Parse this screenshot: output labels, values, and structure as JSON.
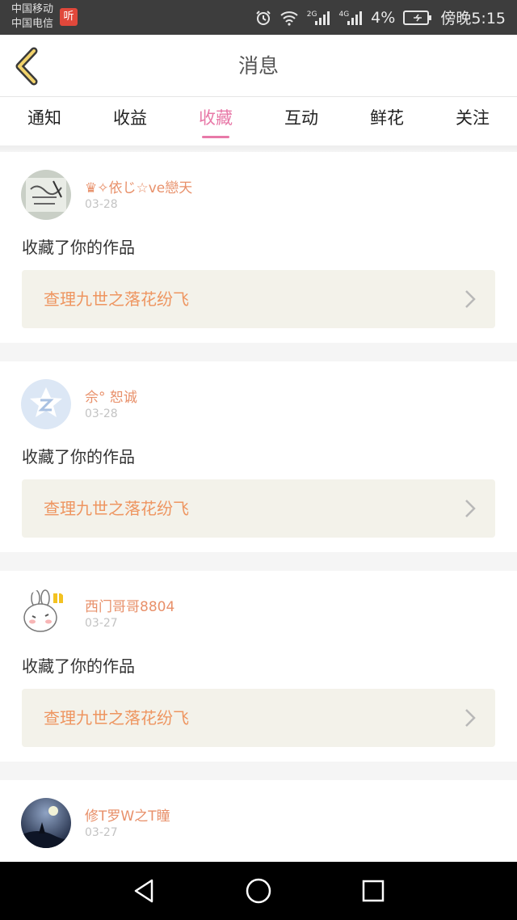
{
  "status": {
    "carrier1": "中国移动",
    "carrier2": "中国电信",
    "app_badge": "听",
    "net2": "2G",
    "net4": "4G",
    "battery": "4%",
    "time": "傍晚5:15"
  },
  "header": {
    "title": "消息"
  },
  "tabs": [
    {
      "label": "通知"
    },
    {
      "label": "收益"
    },
    {
      "label": "收藏"
    },
    {
      "label": "互动"
    },
    {
      "label": "鲜花"
    },
    {
      "label": "关注"
    }
  ],
  "active_tab": "收藏",
  "messages": [
    {
      "user": "♛✧依じ☆ve戀天",
      "date": "03-28",
      "action": "收藏了你的作品",
      "work": "查理九世之落花纷飞"
    },
    {
      "user": "佘° 恕诚",
      "date": "03-28",
      "action": "收藏了你的作品",
      "work": "查理九世之落花纷飞"
    },
    {
      "user": "西门哥哥8804",
      "date": "03-27",
      "action": "收藏了你的作品",
      "work": "查理九世之落花纷飞"
    },
    {
      "user": "修T罗W之T瞳",
      "date": "03-27",
      "action": "",
      "work": ""
    }
  ],
  "colors": {
    "accent": "#e879a8",
    "username": "#e8906a",
    "work_title": "#ee9560",
    "work_bg": "#f3f2ea"
  },
  "icons": {
    "back": "chevron-left-icon",
    "chevron": "chevron-right-icon",
    "alarm": "alarm-icon",
    "wifi": "wifi-icon",
    "signal": "signal-icon",
    "battery": "battery-icon",
    "nav_back": "triangle-back-icon",
    "nav_home": "circle-home-icon",
    "nav_recents": "square-recents-icon"
  }
}
